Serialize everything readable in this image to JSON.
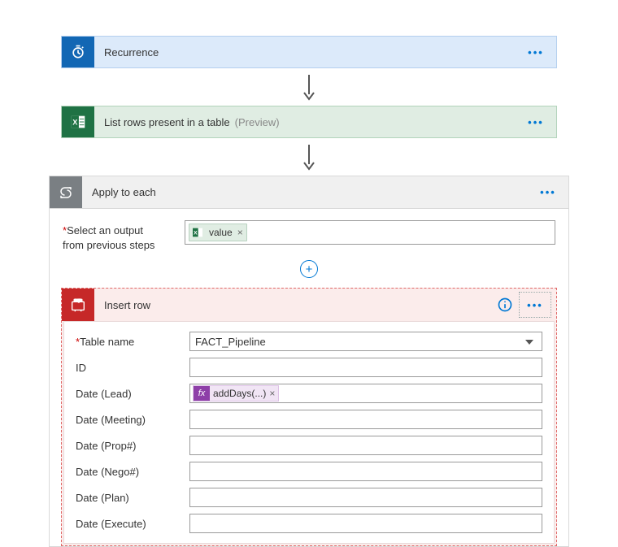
{
  "recurrence": {
    "label": "Recurrence"
  },
  "excel": {
    "label": "List rows present in a table",
    "preview": "(Preview)"
  },
  "apply": {
    "label": "Apply to each"
  },
  "selectOutput": {
    "labelLine1": "Select an output",
    "labelLine2": "from previous steps",
    "token": "value"
  },
  "sql": {
    "title": "Insert row",
    "fields": {
      "tableName": {
        "label": "Table name",
        "value": "FACT_Pipeline",
        "required": true
      },
      "id": {
        "label": "ID"
      },
      "dateLead": {
        "label": "Date (Lead)",
        "fx": "addDays(...)"
      },
      "dateMeeting": {
        "label": "Date (Meeting)"
      },
      "dateProp": {
        "label": "Date (Prop#)"
      },
      "dateNego": {
        "label": "Date (Nego#)"
      },
      "datePlan": {
        "label": "Date (Plan)"
      },
      "dateExecute": {
        "label": "Date (Execute)"
      }
    }
  },
  "glyph": {
    "fx": "fx",
    "star": "*",
    "x": "×",
    "plus": "+",
    "dots": "•••"
  }
}
